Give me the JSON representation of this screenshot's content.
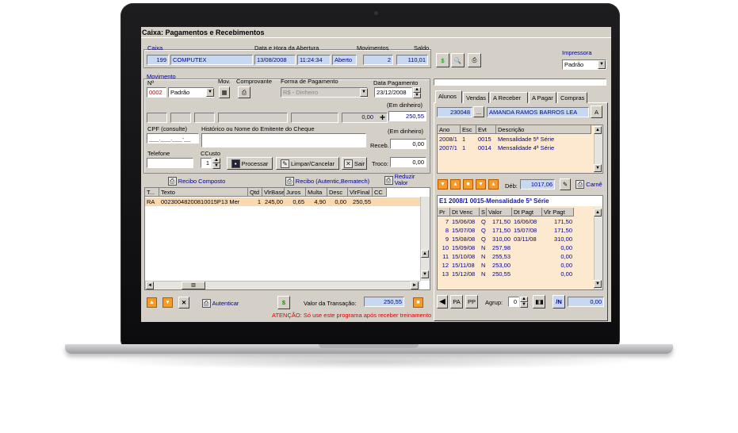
{
  "window": {
    "title": "Caixa: Pagamentos e Recebimentos"
  },
  "caixa": {
    "group": "Caixa",
    "label_data": "Data e Hora da Abertura",
    "label_movimentos": "Movimentos",
    "label_saldo": "Saldo",
    "numero": "199",
    "nome": "COMPUTEX",
    "data": "13/08/2008",
    "hora": "11:24:34",
    "status": "Aberto",
    "movimentos": "2",
    "saldo": "110,01"
  },
  "impressora": {
    "label": "Impressora",
    "value": "Padrão"
  },
  "movimento": {
    "group": "Movimento",
    "label_no": "Nº",
    "label_mov": "Mov.",
    "label_comprovante": "Comprovante",
    "label_forma": "Forma de Pagamento",
    "label_data_pag": "Data Pagamento",
    "numero": "0002",
    "tipo": "Padrão",
    "forma": "R$ - Dinheiro",
    "data_pagamento": "23/12/2008",
    "em_dinheiro_label": "(Em dinheiro)",
    "valor_zero": "0,00",
    "valor_total": "250,55",
    "label_cpf": "CPF (consulte)",
    "cpf_mask": "___.___.___-__",
    "label_historico": "Histórico ou Nome do Emitente do Cheque",
    "label_recebe": "Receb.",
    "recebe_val": "0,00",
    "em_dinheiro_label2": "(Em dinheiro)",
    "label_telefone": "Telefone",
    "label_ccusto": "CCusto",
    "ccusto": "1",
    "processar": "Processar",
    "limpar": "Limpar/Cancelar",
    "sair": "Sair",
    "label_troco": "Troco:",
    "troco": "0,00"
  },
  "recibos": {
    "composto": "Recibo Composto",
    "autentic": "Recibo (Autentic,Bematech)",
    "reduzir": "Reduzir",
    "valor": "Valor"
  },
  "transactions": {
    "headers": [
      "T...",
      "Texto",
      "Qtd",
      "VlrBase",
      "Juros",
      "Multa",
      "Desc",
      "VlrFinal",
      "CC"
    ],
    "rows": [
      [
        "RA",
        "00230048200810015P13 Mer",
        "1",
        "245,00",
        "0,65",
        "4,90",
        "0,00",
        "250,55",
        ""
      ]
    ]
  },
  "bottom": {
    "autenticar": "Autenticar",
    "valor_label": "Valor da Transação:",
    "valor": "250,55",
    "warning": "ATENÇÃO: Só use este programa após receber treinamento"
  },
  "tabs": [
    "Alunos",
    "Vendas",
    "A Receber",
    "A Pagar",
    "Compras"
  ],
  "aluno": {
    "codigo": "230048",
    "dots": "...",
    "nome": "AMANDA RAMOS BARROS LEA",
    "btn": "A"
  },
  "enrollments": {
    "headers": [
      "Ano",
      "Esc",
      "Evt",
      "Descrição"
    ],
    "rows": [
      [
        "2008/1",
        "1",
        "0015",
        "Mensalidade 5ª Série"
      ],
      [
        "2007/1",
        "1",
        "0014",
        "Mensalidade 4ª Série"
      ]
    ]
  },
  "debito": {
    "label": "Déb:",
    "value": "1017,06",
    "carne": "Carnê"
  },
  "parcelas": {
    "title": "E1 2008/1 0015-Mensalidade 5ª Série",
    "headers": [
      "Pr",
      "Dt Venc",
      "S",
      "Valor",
      "Dt Pagt",
      "Vlr Pagt"
    ],
    "rows": [
      [
        "7",
        "15/06/08",
        "Q",
        "171,50",
        "16/06/08",
        "171,50"
      ],
      [
        "8",
        "15/07/08",
        "Q",
        "171,50",
        "15/07/08",
        "171,50"
      ],
      [
        "9",
        "15/08/08",
        "Q",
        "310,00",
        "03/11/08",
        "310,00"
      ],
      [
        "10",
        "15/09/08",
        "N",
        "257,98",
        "",
        "0,00"
      ],
      [
        "11",
        "15/10/08",
        "N",
        "255,53",
        "",
        "0,00"
      ],
      [
        "12",
        "15/11/08",
        "N",
        "253,00",
        "",
        "0,00"
      ],
      [
        "13",
        "15/12/08",
        "N",
        "250,55",
        "",
        "0,00"
      ]
    ]
  },
  "right_bottom": {
    "pa": "PA",
    "pp": "PP",
    "agrup_label": "Agrup:",
    "agrup": "0",
    "n": "/N",
    "valor": "0,00"
  },
  "icons": {
    "dollar": "dollar-icon",
    "preview": "preview-icon",
    "printer": "printer-icon",
    "calculator": "calculator-icon",
    "save": "save-icon",
    "close": "close-icon",
    "arrows": "arrow-icon"
  },
  "colors": {
    "field": "#c8d8f0",
    "selected": "#fbd9b0",
    "header_blue": "#1a1aa0",
    "orange": "#f59b28"
  }
}
